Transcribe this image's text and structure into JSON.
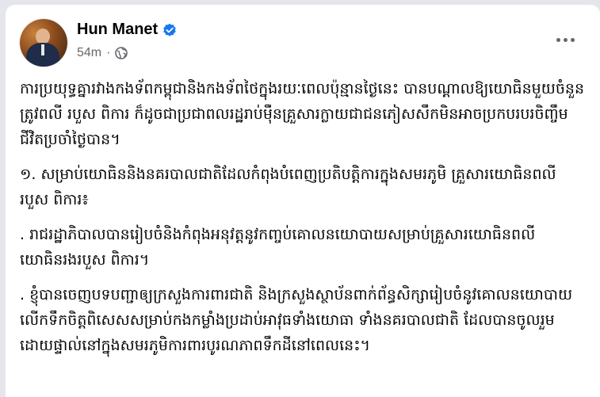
{
  "author": {
    "name": "Hun Manet",
    "verified": true
  },
  "meta": {
    "time": "54m",
    "separator": "·",
    "audience_icon": "globe-icon"
  },
  "menu_icon": "more-options-icon",
  "post": {
    "paragraphs": [
      "ការប្រយុទ្ធគ្នារវាងកងទ័ពកម្ពុជានិងកងទ័ពថៃក្នុងរយៈពេលប៉ុន្មានថ្ងៃនេះ បានបណ្ដាលឱ្យយោធិនមួយចំនួនត្រូវពលី របួស ពិការ ក៏ដូចជាប្រជាពលរដ្ឋរាប់ម៉ឺនគ្រួសារក្លាយជាជនភៀសសឹកមិនអាចប្រកបរបរចិញ្ចឹមជីវិតប្រចាំថ្ងៃបាន។",
      "១. សម្រាប់យោធិននិងនគរបាលជាតិដែលកំពុងបំពេញប្រតិបត្តិការក្នុងសមរភូមិ គ្រួសារយោធិនពលី របួស ពិការ៖",
      ". រាជរដ្ឋាភិបាលបានរៀបចំនិងកំពុងអនុវត្តនូវកញ្ចប់គោលនយោបាយសម្រាប់គ្រួសារយោធិនពលី យោធិនរងរបួស ពិការ។",
      ". ខ្ញុំបានចេញបទបញ្ជាឲ្យក្រសួងការពារជាតិ និងក្រសួងស្ថាប័នពាក់ព័ន្ធសិក្សារៀបចំនូវគោលនយោបាយលើកទឹកចិត្តពិសេសសម្រាប់កងកម្លាំងប្រដាប់អាវុធទាំងយោធា ទាំងនគរបាលជាតិ ដែលបានចូលរួមដោយផ្ទាល់នៅក្នុងសមរភូមិការពារបូរណភាពទឹកដីនៅពេលនេះ។"
    ]
  },
  "colors": {
    "background": "#e4e6eb",
    "card": "#ffffff",
    "text": "#050505",
    "secondary_text": "#65676b",
    "verified_badge": "#1877f2"
  }
}
